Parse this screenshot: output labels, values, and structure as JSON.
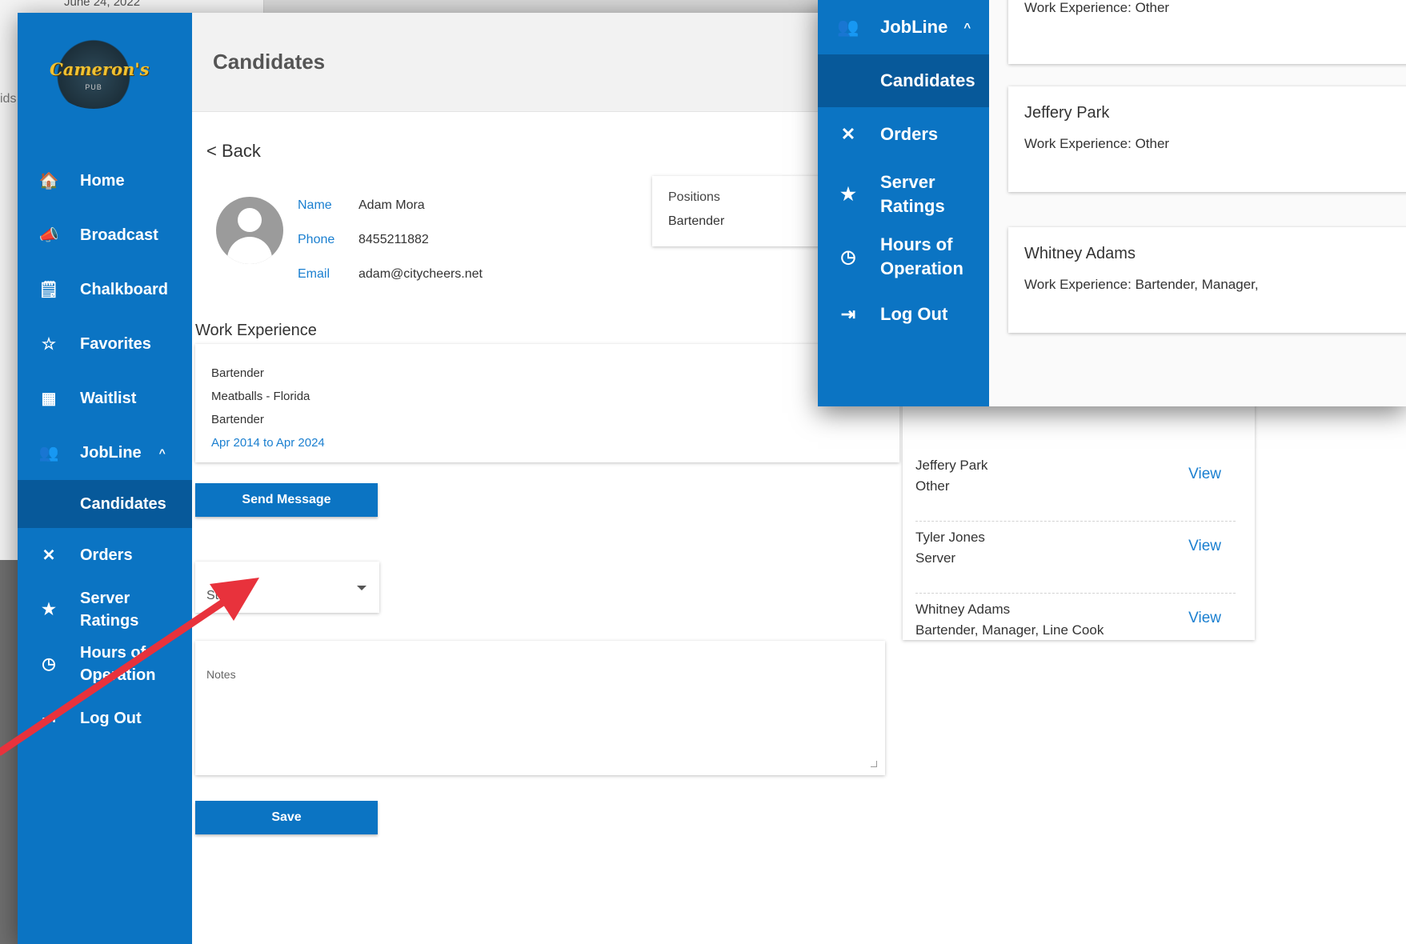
{
  "background": {
    "date_partial": "June 24, 2022",
    "left_edge_text": "ids"
  },
  "app": {
    "logo_text": "Cameron's",
    "logo_sub": "PUB"
  },
  "sidebar": {
    "items": [
      {
        "label": "Home",
        "icon": "home-icon",
        "glyph": "🏠"
      },
      {
        "label": "Broadcast",
        "icon": "megaphone-icon",
        "glyph": "📣"
      },
      {
        "label": "Chalkboard",
        "icon": "chalkboard-icon",
        "glyph": "🗒"
      },
      {
        "label": "Favorites",
        "icon": "star-outline-icon",
        "glyph": "☆"
      },
      {
        "label": "Waitlist",
        "icon": "grid-icon",
        "glyph": "▦"
      },
      {
        "label": "JobLine",
        "icon": "people-search-icon",
        "glyph": "👥",
        "chevron": "^"
      },
      {
        "label": "Candidates",
        "sub": true
      },
      {
        "label": "Orders",
        "icon": "utensils-icon",
        "glyph": "✕"
      },
      {
        "label": "Server Ratings",
        "icon": "star-rating-icon",
        "glyph": "★"
      },
      {
        "label": "Hours of Operation",
        "icon": "clock-icon",
        "glyph": "◷"
      },
      {
        "label": "Log Out",
        "icon": "logout-icon",
        "glyph": "⇥"
      }
    ]
  },
  "header": {
    "title": "Candidates"
  },
  "back": {
    "label": "< Back"
  },
  "candidate": {
    "name_label": "Name",
    "name": "Adam Mora",
    "phone_label": "Phone",
    "phone": "8455211882",
    "email_label": "Email",
    "email": "adam@citycheers.net",
    "positions_label": "Positions",
    "positions_value": "Bartender"
  },
  "work_experience": {
    "title": "Work Experience",
    "entries": [
      {
        "title": "Bartender",
        "company": "Meatballs - Florida",
        "role": "Bartender",
        "dates": "Apr 2014 to Apr 2024"
      }
    ]
  },
  "buttons": {
    "send_message": "Send Message",
    "save": "Save"
  },
  "status": {
    "placeholder": "Status"
  },
  "notes": {
    "placeholder": "Notes"
  },
  "candidate_list": [
    {
      "name": "Jeffery Park",
      "role": "Other",
      "action": "View"
    },
    {
      "name": "Tyler Jones",
      "role": "Server",
      "action": "View"
    },
    {
      "name": "Whitney Adams",
      "role": "Bartender, Manager, Line Cook",
      "action": "View"
    }
  ],
  "overlay": {
    "nav": [
      {
        "label": "JobLine",
        "chevron": "^",
        "glyph": "👥",
        "icon": "people-search-icon"
      },
      {
        "label": "Candidates",
        "sub": true
      },
      {
        "label": "Orders",
        "glyph": "✕",
        "icon": "utensils-icon"
      },
      {
        "label": "Server Ratings",
        "glyph": "★",
        "icon": "star-rating-icon"
      },
      {
        "label": "Hours of Operation",
        "glyph": "◷",
        "icon": "clock-icon"
      },
      {
        "label": "Log Out",
        "glyph": "⇥",
        "icon": "logout-icon"
      }
    ],
    "cards": [
      {
        "name": "",
        "experience": "Work Experience:  Other"
      },
      {
        "name": "Jeffery Park",
        "experience": "Work Experience:  Other"
      },
      {
        "name": "Whitney Adams",
        "experience": "Work Experience:  Bartender, Manager,"
      }
    ]
  },
  "colors": {
    "brand_blue": "#0b74c3",
    "selected_blue": "#07599a",
    "link_blue": "#1a7fd0",
    "annotation_arrow": "#e8323c"
  }
}
